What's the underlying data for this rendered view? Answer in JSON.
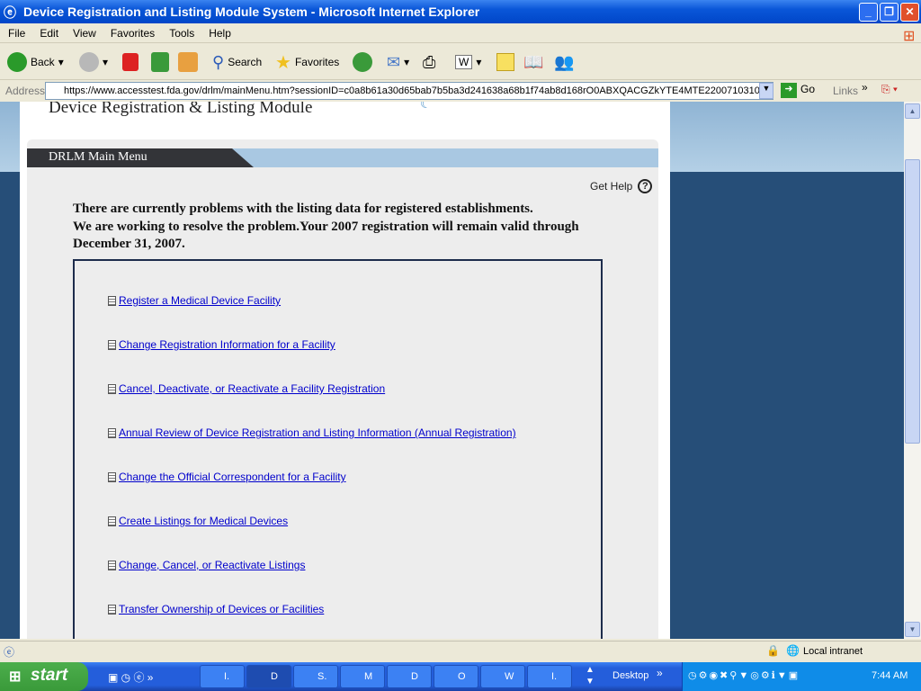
{
  "window": {
    "title": "Device Registration and Listing Module System - Microsoft Internet Explorer"
  },
  "menu": [
    "File",
    "Edit",
    "View",
    "Favorites",
    "Tools",
    "Help"
  ],
  "toolbar": {
    "back": "Back",
    "search": "Search",
    "favorites": "Favorites"
  },
  "address": {
    "label": "Address",
    "url": "https://www.accesstest.fda.gov/drlm/mainMenu.htm?sessionID=c0a8b61a30d65bab7b5ba3d241638a68b1f74ab8d168rO0ABXQACGZkYTE4MTE220071031074",
    "go": "Go",
    "links": "Links"
  },
  "page": {
    "module_title": "Device Registration & Listing Module",
    "menu_header": "DRLM Main Menu",
    "get_help": "Get Help",
    "notice": [
      "There are currently problems with the listing data for registered establishments.",
      "We are working to resolve the problem.Your 2007 registration will remain valid through December 31, 2007."
    ],
    "links": [
      "Register a Medical Device Facility",
      "Change Registration Information for a Facility",
      "Cancel, Deactivate, or Reactivate a Facility Registration",
      "Annual Review of Device Registration and Listing Information (Annual Registration)",
      "Change the Official Correspondent for a Facility",
      "Create Listings for Medical Devices",
      "Change, Cancel, or Reactivate Listings",
      "Transfer Ownership of Devices or Facilities"
    ]
  },
  "status": {
    "zone": "Local intranet"
  },
  "taskbar": {
    "start": "start",
    "tasks": [
      "I.",
      "D",
      "S.",
      "M",
      "D",
      "O",
      "W",
      "I."
    ],
    "desktop": "Desktop",
    "clock": "7:44 AM"
  },
  "colors": {
    "link": "#0000cc",
    "header_dark": "#333438",
    "header_light": "#a9c8e2",
    "box_border": "#1d2c4c"
  }
}
